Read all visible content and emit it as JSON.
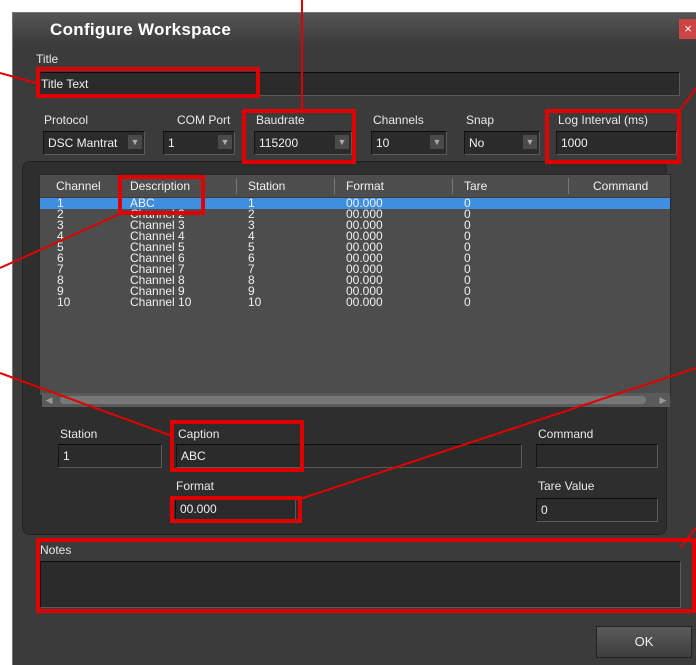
{
  "window": {
    "title": "Configure Workspace",
    "close_glyph": "×"
  },
  "title_section": {
    "label": "Title",
    "value": "Title Text"
  },
  "settings": {
    "protocol": {
      "label": "Protocol",
      "value": "DSC Mantrat"
    },
    "com_port": {
      "label": "COM Port",
      "value": "1"
    },
    "baudrate": {
      "label": "Baudrate",
      "value": "115200"
    },
    "channels": {
      "label": "Channels",
      "value": "10"
    },
    "snap": {
      "label": "Snap",
      "value": "No"
    },
    "log_interval": {
      "label": "Log Interval (ms)",
      "value": "1000"
    }
  },
  "table": {
    "columns": [
      "Channel",
      "Description",
      "Station",
      "Format",
      "Tare",
      "Command"
    ],
    "rows": [
      [
        "1",
        "ABC",
        "1",
        "00.000",
        "0",
        ""
      ],
      [
        "2",
        "Channel 2",
        "2",
        "00.000",
        "0",
        ""
      ],
      [
        "3",
        "Channel 3",
        "3",
        "00.000",
        "0",
        ""
      ],
      [
        "4",
        "Channel 4",
        "4",
        "00.000",
        "0",
        ""
      ],
      [
        "5",
        "Channel 5",
        "5",
        "00.000",
        "0",
        ""
      ],
      [
        "6",
        "Channel 6",
        "6",
        "00.000",
        "0",
        ""
      ],
      [
        "7",
        "Channel 7",
        "7",
        "00.000",
        "0",
        ""
      ],
      [
        "8",
        "Channel 8",
        "8",
        "00.000",
        "0",
        ""
      ],
      [
        "9",
        "Channel 9",
        "9",
        "00.000",
        "0",
        ""
      ],
      [
        "10",
        "Channel 10",
        "10",
        "00.000",
        "0",
        ""
      ]
    ],
    "selected_row": 0
  },
  "detail": {
    "station": {
      "label": "Station",
      "value": "1"
    },
    "caption": {
      "label": "Caption",
      "value": "ABC"
    },
    "command": {
      "label": "Command",
      "value": ""
    },
    "format": {
      "label": "Format",
      "value": "00.000"
    },
    "tare_value": {
      "label": "Tare Value",
      "value": "0"
    }
  },
  "notes": {
    "label": "Notes",
    "value": ""
  },
  "buttons": {
    "ok": "OK"
  },
  "colors": {
    "highlight": "#e00000",
    "selection": "#3f8fe0",
    "dialog_bg": "#3b3b3b"
  }
}
